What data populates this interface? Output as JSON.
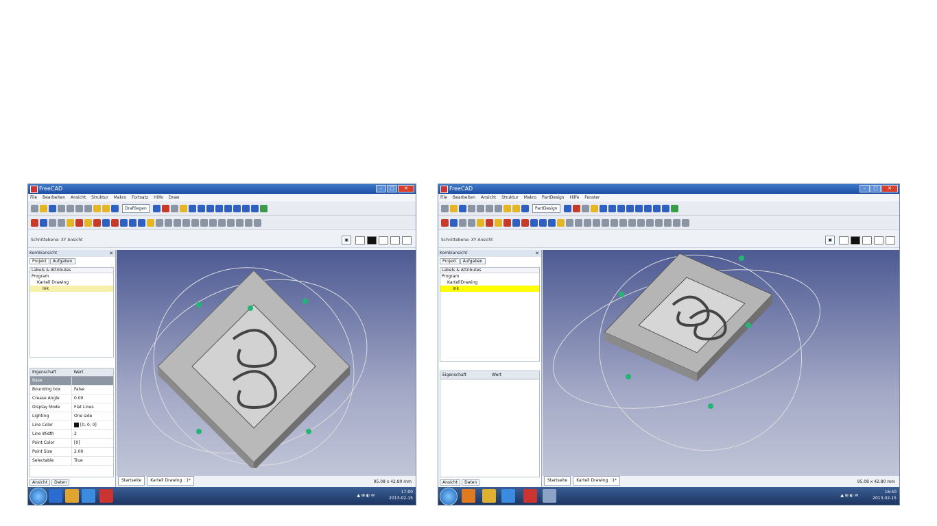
{
  "left": {
    "title": "FreeCAD",
    "menus": [
      "File",
      "Bearbeiten",
      "Ansicht",
      "Struktur",
      "Makro",
      "Fortsatz",
      "Hilfe",
      "Draw"
    ],
    "workbench": "Draftlegen",
    "toolbar_label": "Schnittebene: XY Ansicht",
    "panel_title": "Kombiansicht",
    "tabs": [
      "Projekt",
      "Aufgaben"
    ],
    "tree_header": "Labels & Attributes",
    "tree": {
      "root": "Program",
      "doc": "Kartell Drawing",
      "item": "Ink"
    },
    "props_header": [
      "Eigenschaft",
      "Wert"
    ],
    "props": [
      {
        "name": "Base",
        "value": ""
      },
      {
        "name": "Bounding box",
        "value": "False"
      },
      {
        "name": "Crease Angle",
        "value": "0.00"
      },
      {
        "name": "Display Mode",
        "value": "Flat Lines"
      },
      {
        "name": "Lighting",
        "value": "One side"
      },
      {
        "name": "Line Color",
        "value": "[0, 0, 0]"
      },
      {
        "name": "Line Width",
        "value": "2"
      },
      {
        "name": "Point Color",
        "value": "[0]"
      },
      {
        "name": "Point Size",
        "value": "2.00"
      },
      {
        "name": "Selectable",
        "value": "True"
      }
    ],
    "bottom_tabs": [
      "Ansicht",
      "Daten"
    ],
    "doc_tabs": [
      "Startseite",
      "Kartell Drawing : 1*"
    ],
    "coords": "95.08 x 42.80 mm"
  },
  "right": {
    "title": "FreeCAD",
    "menus": [
      "File",
      "Bearbeiten",
      "Ansicht",
      "Struktur",
      "Makro",
      "PartDesign",
      "Hilfe",
      "Fenster"
    ],
    "workbench": "PartDesign",
    "toolbar_label": "Schnittebene: XY Ansicht",
    "panel_title": "Kombiansicht",
    "tabs": [
      "Projekt",
      "Aufgaben"
    ],
    "tree_header": "Labels & Attributes",
    "tree": {
      "root": "Program",
      "doc": "KartellDrawing",
      "item": "Ink"
    },
    "props_header": [
      "Eigenschaft",
      "Wert"
    ],
    "bottom_tabs": [
      "Ansicht",
      "Daten"
    ],
    "doc_tabs": [
      "Startseite",
      "Kartell Drawing : 1*"
    ],
    "coords": "95.08 x 42.80 mm"
  },
  "clock_left": {
    "time": "17:00",
    "date": "2013-02-15"
  },
  "clock_right": {
    "time": "16:50",
    "date": "2013-02-15"
  },
  "colors": {
    "title_bar": "#1d4fa3",
    "viewport_top": "#4d5a93",
    "viewport_bottom": "#c5c9da",
    "selection": "#ffff00",
    "taskbar": "#1d3563"
  }
}
